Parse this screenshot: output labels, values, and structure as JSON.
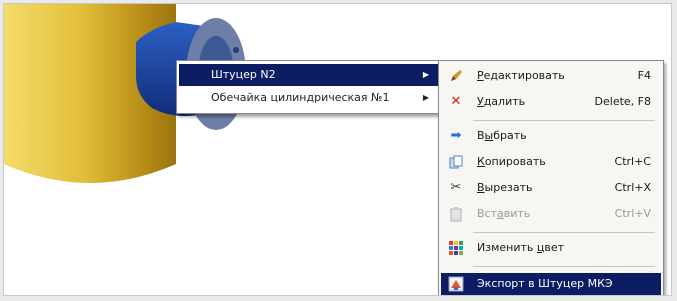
{
  "context_menu": {
    "items": [
      {
        "label": "Штуцер N2"
      },
      {
        "label": "Обечайка цилиндрическая №1"
      }
    ]
  },
  "submenu": {
    "edit": {
      "before": "",
      "key": "Р",
      "after": "едактировать",
      "shortcut": "F4"
    },
    "delete": {
      "before": "",
      "key": "У",
      "after": "далить",
      "shortcut": "Delete, F8"
    },
    "select": {
      "before": "В",
      "key": "ы",
      "after": "брать"
    },
    "copy": {
      "before": "",
      "key": "К",
      "after": "опировать",
      "shortcut": "Ctrl+C"
    },
    "cut": {
      "before": "",
      "key": "В",
      "after": "ырезать",
      "shortcut": "Ctrl+X"
    },
    "paste": {
      "before": "Вст",
      "key": "а",
      "after": "вить",
      "shortcut": "Ctrl+V",
      "enabled": false
    },
    "color": {
      "before": "Изменить ",
      "key": "ц",
      "after": "вет"
    },
    "export": {
      "label": "Экспорт в Штуцер МКЭ"
    }
  },
  "colors": {
    "highlight": "#0d1d63",
    "vessel": "#d9b430",
    "nozzle": "#1e47a6",
    "flange": "#6d7fa8"
  }
}
